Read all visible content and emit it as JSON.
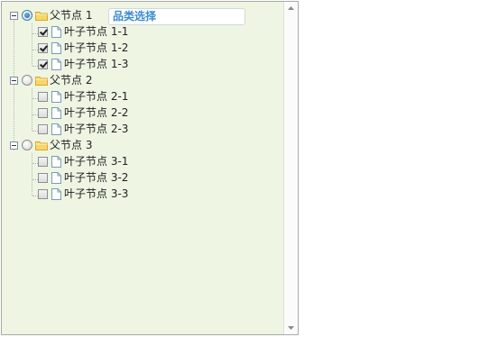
{
  "category": {
    "label": "品类选择"
  },
  "tree": {
    "nodes": [
      {
        "label": "父节点 1",
        "selected": true,
        "children": [
          {
            "label": "叶子节点 1-1",
            "checked": true
          },
          {
            "label": "叶子节点 1-2",
            "checked": true
          },
          {
            "label": "叶子节点 1-3",
            "checked": true
          }
        ]
      },
      {
        "label": "父节点 2",
        "selected": false,
        "children": [
          {
            "label": "叶子节点 2-1",
            "checked": false
          },
          {
            "label": "叶子节点 2-2",
            "checked": false
          },
          {
            "label": "叶子节点 2-3",
            "checked": false
          }
        ]
      },
      {
        "label": "父节点 3",
        "selected": false,
        "children": [
          {
            "label": "叶子节点 3-1",
            "checked": false
          },
          {
            "label": "叶子节点 3-2",
            "checked": false
          },
          {
            "label": "叶子节点 3-3",
            "checked": false
          }
        ]
      }
    ]
  },
  "colors": {
    "panel_bg": "#eef5e3",
    "category_text": "#3b8bd0"
  },
  "icons": {
    "folder": "folder-icon",
    "file": "file-icon",
    "expander": "collapse-icon"
  }
}
